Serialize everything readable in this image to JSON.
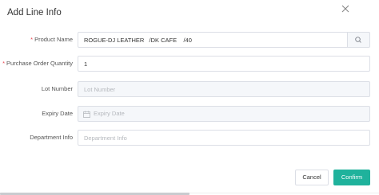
{
  "dialog": {
    "title": "Add Line Info"
  },
  "form": {
    "required_mark": "*",
    "product_name": {
      "label": "Product Name",
      "value": "ROGUE-DJ LEATHER   /DK CAFE    /40"
    },
    "purchase_order_quantity": {
      "label": "Purchase Order Quantity",
      "value": "1"
    },
    "lot_number": {
      "label": "Lot Number",
      "placeholder": "Lot Number"
    },
    "expiry_date": {
      "label": "Expiry Date",
      "placeholder": "Expiry Date"
    },
    "department_info": {
      "label": "Department Info",
      "placeholder": "Department Info"
    }
  },
  "footer": {
    "cancel_label": "Cancel",
    "confirm_label": "Confirm"
  },
  "icons": {
    "close": "close-icon",
    "search": "search-icon",
    "calendar": "calendar-icon"
  },
  "colors": {
    "accent": "#1fb29c",
    "required": "#e8434e",
    "border": "#dcdfe6",
    "disabled_bg": "#f5f7fa"
  }
}
